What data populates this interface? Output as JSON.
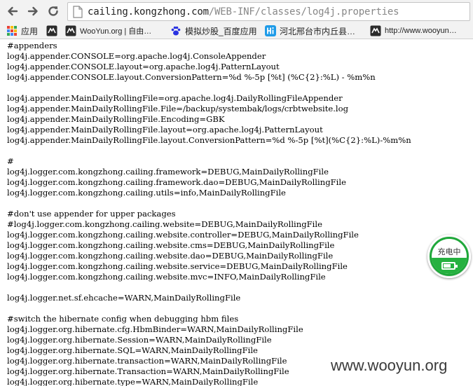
{
  "browser": {
    "address_bar": {
      "host": "cailing.kongzhong.com",
      "path": "/WEB-INF/classes/log4j.properties"
    }
  },
  "bookmarks": {
    "items": [
      {
        "label": "应用",
        "icon": "apps-grid-icon"
      },
      {
        "label": "",
        "icon": "wooyun-logo-icon"
      },
      {
        "label": "WooYun.org | 自由…",
        "icon": "wooyun-logo-icon"
      },
      {
        "label": "模拟炒股_百度应用",
        "icon": "baidu-paw-icon"
      },
      {
        "label": "河北邢台市内丘县…",
        "icon": "hi-badge-icon"
      },
      {
        "label": "http://www.wooyun…",
        "icon": "wooyun-logo-icon"
      }
    ]
  },
  "file_lines": [
    "#appenders",
    "log4j.appender.CONSOLE=org.apache.log4j.ConsoleAppender",
    "log4j.appender.CONSOLE.layout=org.apache.log4j.PatternLayout",
    "log4j.appender.CONSOLE.layout.ConversionPattern=%d %-5p [%t] (%C{2}:%L) - %m%n",
    "",
    "log4j.appender.MainDailyRollingFile=org.apache.log4j.DailyRollingFileAppender",
    "log4j.appender.MainDailyRollingFile.File=/backup/systembak/logs/crbtwebsite.log",
    "log4j.appender.MainDailyRollingFile.Encoding=GBK",
    "log4j.appender.MainDailyRollingFile.layout=org.apache.log4j.PatternLayout",
    "log4j.appender.MainDailyRollingFile.layout.ConversionPattern=%d %-5p [%t](%C{2}:%L)-%m%n",
    "",
    "#",
    "log4j.logger.com.kongzhong.cailing.framework=DEBUG,MainDailyRollingFile",
    "log4j.logger.com.kongzhong.cailing.framework.dao=DEBUG,MainDailyRollingFile",
    "log4j.logger.com.kongzhong.cailing.utils=info,MainDailyRollingFile",
    "",
    "#don't use appender for upper packages",
    "#log4j.logger.com.kongzhong.cailing.website=DEBUG,MainDailyRollingFile",
    "log4j.logger.com.kongzhong.cailing.website.controller=DEBUG,MainDailyRollingFile",
    "log4j.logger.com.kongzhong.cailing.website.cms=DEBUG,MainDailyRollingFile",
    "log4j.logger.com.kongzhong.cailing.website.dao=DEBUG,MainDailyRollingFile",
    "log4j.logger.com.kongzhong.cailing.website.service=DEBUG,MainDailyRollingFile",
    "log4j.logger.com.kongzhong.cailing.website.mvc=INFO,MainDailyRollingFile",
    "",
    "log4j.logger.net.sf.ehcache=WARN,MainDailyRollingFile",
    "",
    "#switch the hibernate config when debugging hbm files",
    "log4j.logger.org.hibernate.cfg.HbmBinder=WARN,MainDailyRollingFile",
    "log4j.logger.org.hibernate.Session=WARN,MainDailyRollingFile",
    "log4j.logger.org.hibernate.SQL=WARN,MainDailyRollingFile",
    "log4j.logger.org.hibernate.transaction=WARN,MainDailyRollingFile",
    "log4j.logger.org.hibernate.Transaction=WARN,MainDailyRollingFile",
    "log4j.logger.org.hibernate.type=WARN,MainDailyRollingFile"
  ],
  "battery_widget": {
    "label": "充电中",
    "charge_fraction": 0.7,
    "accent_color": "#25b13f"
  },
  "watermark": {
    "text": "www.wooyun.org"
  }
}
